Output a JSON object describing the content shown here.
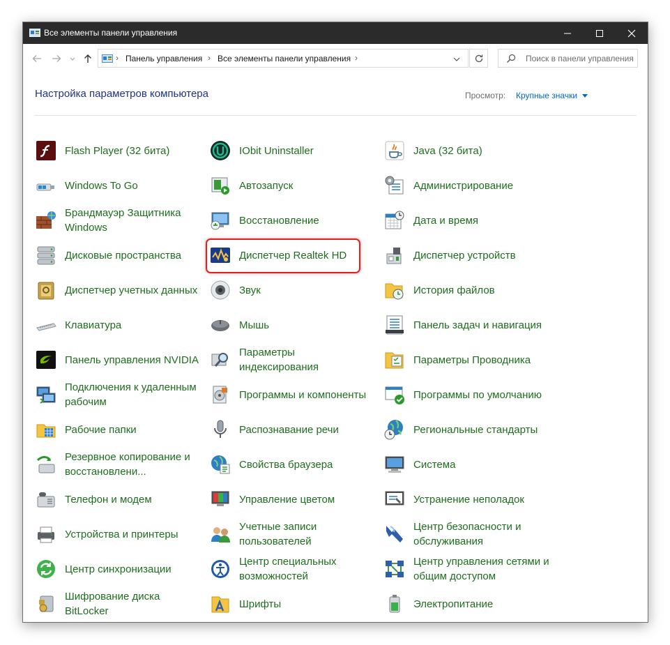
{
  "window": {
    "title": "Все элементы панели управления"
  },
  "address": {
    "segments": [
      "Панель управления",
      "Все элементы панели управления"
    ]
  },
  "search": {
    "placeholder": "Поиск в панели управления"
  },
  "header": {
    "title": "Настройка параметров компьютера",
    "view_label": "Просмотр:",
    "view_value": "Крупные значки"
  },
  "highlighted_item": "Диспетчер Realtek HD",
  "columns": [
    {
      "items": [
        {
          "label": "Flash Player (32 бита)",
          "icon": "flash-player-icon"
        },
        {
          "label": "Windows To Go",
          "icon": "windows-to-go-icon"
        },
        {
          "label": "Брандмауэр Защитника Windows",
          "icon": "firewall-icon"
        },
        {
          "label": "Дисковые пространства",
          "icon": "storage-spaces-icon"
        },
        {
          "label": "Диспетчер учетных данных",
          "icon": "credential-manager-icon"
        },
        {
          "label": "Клавиатура",
          "icon": "keyboard-icon"
        },
        {
          "label": "Панель управления NVIDIA",
          "icon": "nvidia-icon"
        },
        {
          "label": "Подключения к удаленным рабочим",
          "icon": "remote-desktop-icon"
        },
        {
          "label": "Рабочие папки",
          "icon": "work-folders-icon"
        },
        {
          "label": "Резервное копирование и восстановлени...",
          "icon": "backup-restore-icon"
        },
        {
          "label": "Телефон и модем",
          "icon": "phone-modem-icon"
        },
        {
          "label": "Устройства и принтеры",
          "icon": "devices-printers-icon"
        },
        {
          "label": "Центр синхронизации",
          "icon": "sync-center-icon"
        },
        {
          "label": "Шифрование диска BitLocker",
          "icon": "bitlocker-icon"
        }
      ]
    },
    {
      "items": [
        {
          "label": "IObit Uninstaller",
          "icon": "iobit-uninstaller-icon"
        },
        {
          "label": "Автозапуск",
          "icon": "autoplay-icon"
        },
        {
          "label": "Восстановление",
          "icon": "recovery-icon"
        },
        {
          "label": "Диспетчер Realtek HD",
          "icon": "realtek-hd-icon"
        },
        {
          "label": "Звук",
          "icon": "sound-icon"
        },
        {
          "label": "Мышь",
          "icon": "mouse-icon"
        },
        {
          "label": "Параметры индексирования",
          "icon": "indexing-options-icon"
        },
        {
          "label": "Программы и компоненты",
          "icon": "programs-features-icon"
        },
        {
          "label": "Распознавание речи",
          "icon": "speech-recognition-icon"
        },
        {
          "label": "Свойства браузера",
          "icon": "internet-options-icon"
        },
        {
          "label": "Управление цветом",
          "icon": "color-management-icon"
        },
        {
          "label": "Учетные записи пользователей",
          "icon": "user-accounts-icon"
        },
        {
          "label": "Центр специальных возможностей",
          "icon": "ease-of-access-icon"
        },
        {
          "label": "Шрифты",
          "icon": "fonts-icon"
        }
      ]
    },
    {
      "items": [
        {
          "label": "Java (32 бита)",
          "icon": "java-icon"
        },
        {
          "label": "Администрирование",
          "icon": "administrative-tools-icon"
        },
        {
          "label": "Дата и время",
          "icon": "date-time-icon"
        },
        {
          "label": "Диспетчер устройств",
          "icon": "device-manager-icon"
        },
        {
          "label": "История файлов",
          "icon": "file-history-icon"
        },
        {
          "label": "Панель задач и навигация",
          "icon": "taskbar-navigation-icon"
        },
        {
          "label": "Параметры Проводника",
          "icon": "explorer-options-icon"
        },
        {
          "label": "Программы по умолчанию",
          "icon": "default-programs-icon"
        },
        {
          "label": "Региональные стандарты",
          "icon": "region-icon"
        },
        {
          "label": "Система",
          "icon": "system-icon"
        },
        {
          "label": "Устранение неполадок",
          "icon": "troubleshooting-icon"
        },
        {
          "label": "Центр безопасности и обслуживания",
          "icon": "security-maintenance-icon"
        },
        {
          "label": "Центр управления сетями и общим доступом",
          "icon": "network-sharing-icon"
        },
        {
          "label": "Электропитание",
          "icon": "power-options-icon"
        }
      ]
    }
  ]
}
